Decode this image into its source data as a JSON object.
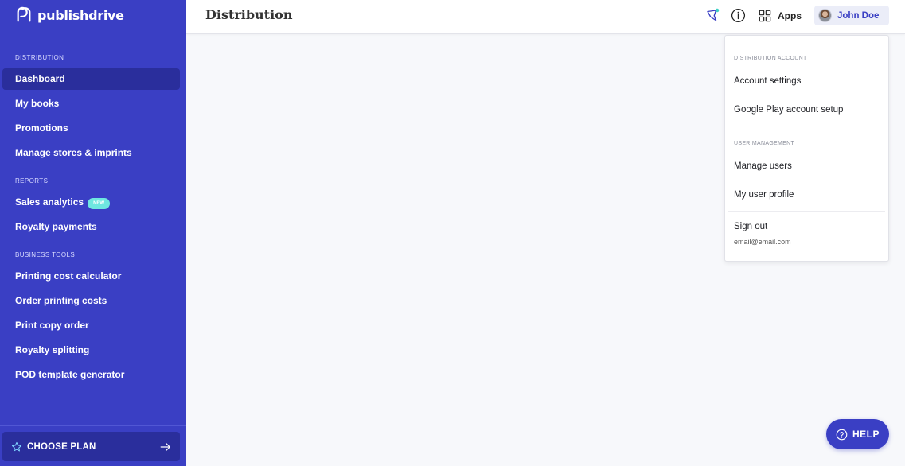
{
  "brand": {
    "name": "publishdrive"
  },
  "sidebar": {
    "sections": [
      {
        "label": "DISTRIBUTION"
      },
      {
        "label": "REPORTS"
      },
      {
        "label": "BUSINESS TOOLS"
      }
    ],
    "items": [
      {
        "label": "Dashboard",
        "active": true
      },
      {
        "label": "My books"
      },
      {
        "label": "Promotions"
      },
      {
        "label": "Manage stores & imprints"
      },
      {
        "label": "Sales analytics",
        "badge": "NEW"
      },
      {
        "label": "Royalty payments"
      },
      {
        "label": "Printing cost calculator"
      },
      {
        "label": "Order printing costs"
      },
      {
        "label": "Print copy order"
      },
      {
        "label": "Royalty splitting"
      },
      {
        "label": "POD template generator"
      }
    ],
    "choose_plan": {
      "label": "CHOOSE PLAN",
      "icon": "star-icon",
      "arrow_icon": "arrow-right-icon"
    }
  },
  "header": {
    "title": "Distribution",
    "icons": [
      "announcements-icon",
      "info-icon"
    ],
    "apps_label": "Apps",
    "user_name": "John Doe"
  },
  "dropdown": {
    "section_distribution": "DISTRIBUTION ACCOUNT",
    "account_settings": "Account settings",
    "google_play_setup": "Google Play account setup",
    "section_user": "USER MANAGEMENT",
    "manage_users": "Manage users",
    "my_user_profile": "My user profile",
    "sign_out": "Sign out",
    "email": "email@email.com"
  },
  "help": {
    "label": "HELP"
  },
  "colors": {
    "sidebar_bg": "#3a3fc4",
    "sidebar_active": "#2a2e9c",
    "badge_new": "#6ee7e0",
    "accent_dot": "#3fd1c4",
    "content_bg": "#f7f8fb"
  }
}
